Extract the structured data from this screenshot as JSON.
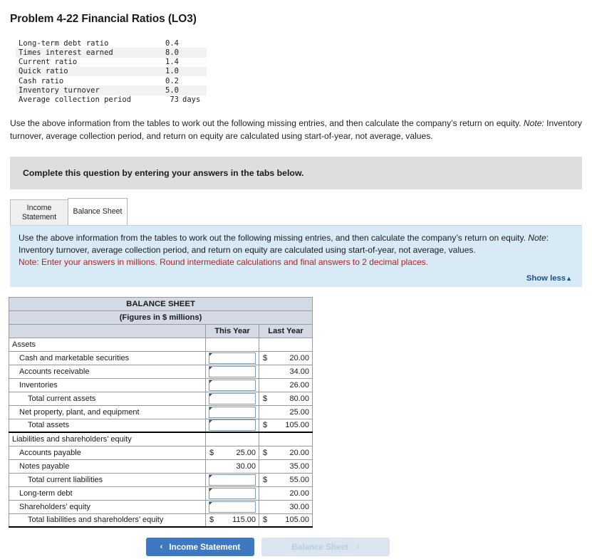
{
  "page_title": "Problem 4-22 Financial Ratios (LO3)",
  "ratios": {
    "rows": [
      {
        "label": "Long-term debt ratio",
        "value": "0.4",
        "unit": ""
      },
      {
        "label": "Times interest earned",
        "value": "8.0",
        "unit": ""
      },
      {
        "label": "Current ratio",
        "value": "1.4",
        "unit": ""
      },
      {
        "label": "Quick ratio",
        "value": "1.0",
        "unit": ""
      },
      {
        "label": "Cash ratio",
        "value": "0.2",
        "unit": ""
      },
      {
        "label": "Inventory turnover",
        "value": "5.0",
        "unit": ""
      },
      {
        "label": "Average collection period",
        "value": "73",
        "unit": "days"
      }
    ]
  },
  "intro": {
    "part1": "Use the above information from the tables to work out the following missing entries, and then calculate the company’s return on equity. ",
    "note_word": "Note:",
    "part2": " Inventory turnover, average collection period, and return on equity are calculated using start-of-year, not average, values."
  },
  "banner": {
    "text": "Complete this question by entering your answers in the tabs below."
  },
  "tabs": [
    {
      "label": "Income Statement",
      "state": "inactive"
    },
    {
      "label": "Balance Sheet",
      "state": "active"
    }
  ],
  "info_panel": {
    "part1": "Use the above information from the tables to work out the following missing entries, and then calculate the company’s return on equity. ",
    "note_word": "Note",
    "part2": ": Inventory turnover, average collection period, and return on equity are calculated using start-of-year, not average, values.",
    "red_note": "Note: Enter your answers in millions. Round intermediate calculations and final answers to 2 decimal places.",
    "show_less": "Show less",
    "show_less_caret": "▲"
  },
  "balance_sheet": {
    "title": "BALANCE SHEET",
    "subtitle": "(Figures in $ millions)",
    "columns": [
      "",
      "This Year",
      "Last Year"
    ],
    "rows": [
      {
        "label": "Assets",
        "indent": 0,
        "kind": "section",
        "this_year": "",
        "last_year": ""
      },
      {
        "label": "Cash and marketable securities",
        "indent": 1,
        "kind": "input",
        "this_year": "",
        "last_year_cur": "$",
        "last_year": "20.00"
      },
      {
        "label": "Accounts receivable",
        "indent": 1,
        "kind": "input",
        "this_year": "",
        "last_year_cur": "",
        "last_year": "34.00"
      },
      {
        "label": "Inventories",
        "indent": 1,
        "kind": "input",
        "this_year": "",
        "last_year_cur": "",
        "last_year": "26.00"
      },
      {
        "label": "Total current assets",
        "indent": 2,
        "kind": "input",
        "this_year": "",
        "last_year_cur": "$",
        "last_year": "80.00"
      },
      {
        "label": "Net property, plant, and equipment",
        "indent": 1,
        "kind": "input",
        "this_year": "",
        "last_year_cur": "",
        "last_year": "25.00"
      },
      {
        "label": "Total assets",
        "indent": 2,
        "kind": "input",
        "rule": "thick",
        "this_year": "",
        "last_year_cur": "$",
        "last_year": "105.00"
      },
      {
        "label": "Liabilities and shareholders’ equity",
        "indent": 0,
        "kind": "section",
        "this_year": "",
        "last_year": ""
      },
      {
        "label": "Accounts payable",
        "indent": 1,
        "kind": "value",
        "this_year_cur": "$",
        "this_year": "25.00",
        "last_year_cur": "$",
        "last_year": "20.00"
      },
      {
        "label": "Notes payable",
        "indent": 1,
        "kind": "value",
        "this_year_cur": "",
        "this_year": "30.00",
        "last_year_cur": "",
        "last_year": "35.00"
      },
      {
        "label": "Total current liabilities",
        "indent": 2,
        "kind": "input",
        "this_year": "",
        "last_year_cur": "$",
        "last_year": "55.00"
      },
      {
        "label": "Long-term debt",
        "indent": 1,
        "kind": "input",
        "this_year": "",
        "last_year_cur": "",
        "last_year": "20.00"
      },
      {
        "label": "Shareholders’ equity",
        "indent": 1,
        "kind": "input",
        "this_year": "",
        "last_year_cur": "",
        "last_year": "30.00"
      },
      {
        "label": "Total liabilities and shareholders’ equity",
        "indent": 2,
        "kind": "value",
        "rule": "thick",
        "this_year_cur": "$",
        "this_year": "115.00",
        "last_year_cur": "$",
        "last_year": "105.00"
      }
    ]
  },
  "nav": {
    "prev_label": "Income Statement",
    "prev_chevron": "‹",
    "next_label": "Balance Sheet",
    "next_chevron": "›"
  }
}
